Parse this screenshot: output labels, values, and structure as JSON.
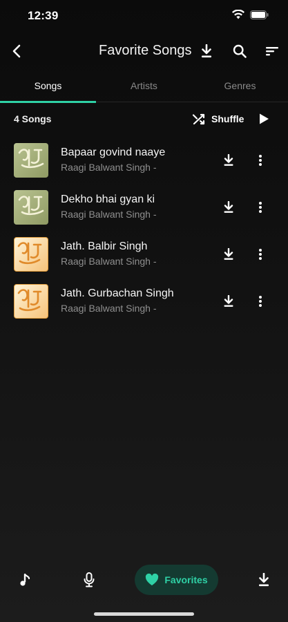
{
  "status": {
    "time": "12:39"
  },
  "header": {
    "title": "Favorite Songs"
  },
  "tabs": [
    {
      "label": "Songs",
      "active": true
    },
    {
      "label": "Artists",
      "active": false
    },
    {
      "label": "Genres",
      "active": false
    }
  ],
  "toolbar": {
    "count_label": "4 Songs",
    "shuffle_label": "Shuffle"
  },
  "songs": [
    {
      "title": "Bapaar govind naaye",
      "artist": "Raagi Balwant Singh -",
      "art": "green-artwork"
    },
    {
      "title": "Dekho bhai gyan ki",
      "artist": "Raagi Balwant Singh -",
      "art": "green-artwork"
    },
    {
      "title": "Jath. Balbir Singh",
      "artist": "Raagi Balwant Singh -",
      "art": "orange-artwork"
    },
    {
      "title": "Jath. Gurbachan Singh",
      "artist": "Raagi Balwant Singh -",
      "art": "orange-artwork"
    }
  ],
  "bottom_nav": {
    "favorites_label": "Favorites"
  },
  "colors": {
    "accent": "#2fd1a6",
    "background": "#0b0b0b",
    "secondary_text": "#8f8f8f"
  },
  "icons": [
    "back-arrow-icon",
    "download-icon",
    "search-icon",
    "sort-icon",
    "shuffle-icon",
    "play-icon",
    "more-vertical-icon",
    "music-note-icon",
    "microphone-icon",
    "heart-icon"
  ]
}
